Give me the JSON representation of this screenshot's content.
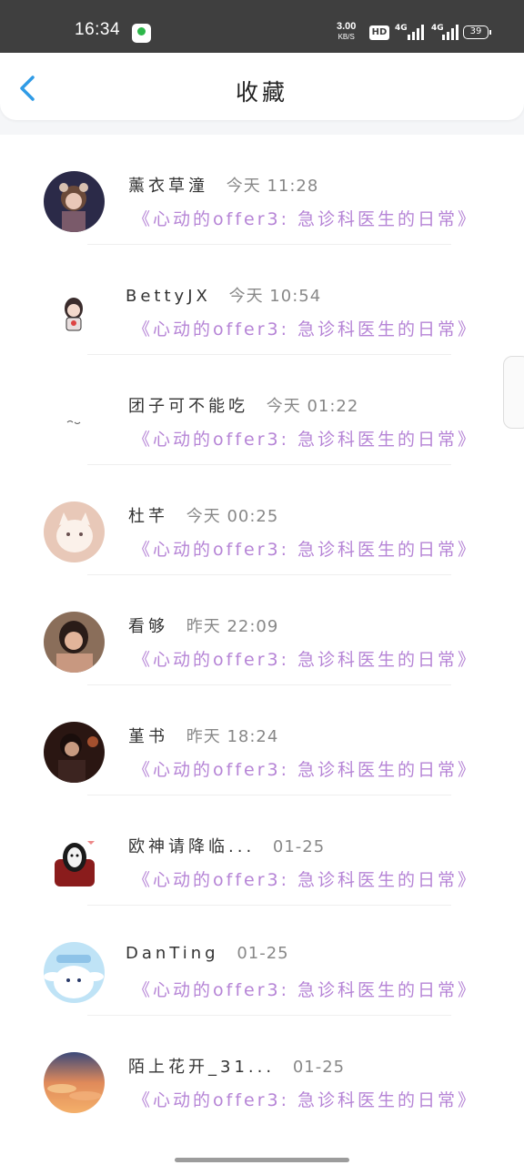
{
  "status_bar": {
    "time": "16:34",
    "net_speed": "3.00",
    "net_unit": "KB/S",
    "hd_label": "HD",
    "signal1_label": "4G",
    "signal2_label": "4G",
    "battery": "39"
  },
  "header": {
    "title": "收藏"
  },
  "favorites": [
    {
      "name": "薰衣草潼",
      "time": "今天 11:28",
      "title": "《心动的offer3: 急诊科医生的日常》"
    },
    {
      "name": "BettyJX",
      "time": "今天 10:54",
      "title": "《心动的offer3: 急诊科医生的日常》"
    },
    {
      "name": "团子可不能吃",
      "time": "今天 01:22",
      "title": "《心动的offer3: 急诊科医生的日常》"
    },
    {
      "name": "杜芊",
      "time": "今天 00:25",
      "title": "《心动的offer3: 急诊科医生的日常》"
    },
    {
      "name": "看够",
      "time": "昨天 22:09",
      "title": "《心动的offer3: 急诊科医生的日常》"
    },
    {
      "name": "堇书",
      "time": "昨天 18:24",
      "title": "《心动的offer3: 急诊科医生的日常》"
    },
    {
      "name": "欧神请降临...",
      "time": "01-25",
      "title": "《心动的offer3: 急诊科医生的日常》"
    },
    {
      "name": "DanTing",
      "time": "01-25",
      "title": "《心动的offer3: 急诊科医生的日常》"
    },
    {
      "name": "陌上花开_31...",
      "time": "01-25",
      "title": "《心动的offer3: 急诊科医生的日常》"
    }
  ],
  "colors": {
    "accent": "#2f9be6",
    "link": "#b684d6",
    "statusbar": "#3f3f3f"
  },
  "icons": {
    "back": "chevron-left-icon"
  }
}
